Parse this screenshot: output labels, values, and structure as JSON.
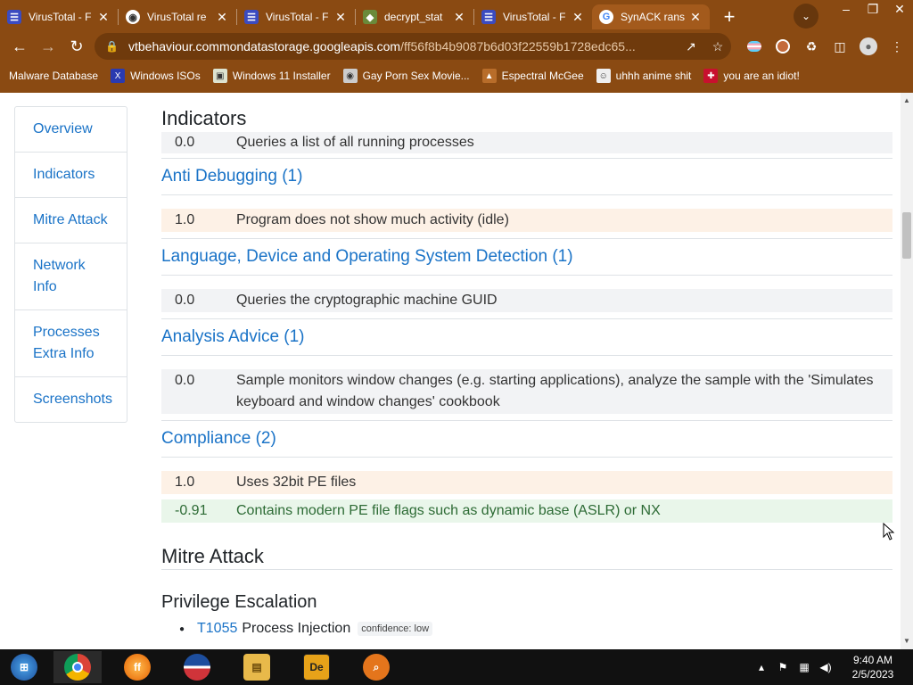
{
  "browser": {
    "tabs": [
      {
        "title": "VirusTotal - F",
        "favicon": "virustotal-icon",
        "color": "#3b4bc0",
        "active": false
      },
      {
        "title": "VirusTotal re",
        "favicon": "chrome-icon",
        "color": "#ffffff",
        "active": false
      },
      {
        "title": "VirusTotal - F",
        "favicon": "virustotal-icon",
        "color": "#3b4bc0",
        "active": false
      },
      {
        "title": "decrypt_stat",
        "favicon": "github-icon",
        "color": "#6a8a3a",
        "active": false
      },
      {
        "title": "VirusTotal - F",
        "favicon": "virustotal-icon",
        "color": "#3b4bc0",
        "active": false
      },
      {
        "title": "SynACK rans",
        "favicon": "google-icon",
        "color": "#ffffff",
        "active": true
      }
    ],
    "url_host": "vtbehaviour.commondatastorage.googleapis.com",
    "url_path": "/ff56f8b4b9087b6d03f22559b1728edc65...",
    "bookmarks": [
      {
        "label": "Malware Database",
        "icon": "bookmark-icon"
      },
      {
        "label": "Windows ISOs",
        "icon": "x-icon"
      },
      {
        "label": "Windows 11 Installer",
        "icon": "image-icon"
      },
      {
        "label": "Gay Porn Sex Movie...",
        "icon": "site-icon"
      },
      {
        "label": "Espectral McGee",
        "icon": "site-icon"
      },
      {
        "label": "uhhh anime shit",
        "icon": "anime-icon"
      },
      {
        "label": "you are an idiot!",
        "icon": "flag-icon"
      }
    ]
  },
  "sidenav": {
    "overview": "Overview",
    "indicators": "Indicators",
    "mitre": "Mitre Attack",
    "network": "Network Info",
    "processes": "Processes Extra Info",
    "screenshots": "Screenshots"
  },
  "report": {
    "indicators_heading": "Indicators",
    "top_row": {
      "score": "0.0",
      "desc": "Queries a list of all running processes"
    },
    "categories": [
      {
        "title": "Anti Debugging (1)",
        "rows": [
          {
            "score": "1.0",
            "desc": "Program does not show much activity (idle)",
            "level": "warn"
          }
        ]
      },
      {
        "title": "Language, Device and Operating System Detection (1)",
        "rows": [
          {
            "score": "0.0",
            "desc": "Queries the cryptographic machine GUID",
            "level": "neutral"
          }
        ]
      },
      {
        "title": "Analysis Advice (1)",
        "rows": [
          {
            "score": "0.0",
            "desc": "Sample monitors window changes (e.g. starting applications), analyze the sample with the 'Simulates keyboard and window changes' cookbook",
            "level": "neutral"
          }
        ]
      },
      {
        "title": "Compliance (2)",
        "rows": [
          {
            "score": "1.0",
            "desc": "Uses 32bit PE files",
            "level": "warn"
          },
          {
            "score": "-0.91",
            "desc": "Contains modern PE file flags such as dynamic base (ASLR) or NX",
            "level": "good"
          }
        ]
      }
    ],
    "mitre_heading": "Mitre Attack",
    "tactic": "Privilege Escalation",
    "technique": {
      "id": "T1055",
      "name": "Process Injection",
      "confidence": "confidence: low"
    }
  },
  "taskbar": {
    "apps": [
      "start-orb-icon",
      "chrome-icon",
      "firefox-icon",
      "obama-icon",
      "file-explorer-icon",
      "de-app-icon",
      "search-magnifier-icon"
    ],
    "time": "9:40 AM",
    "date": "2/5/2023"
  },
  "colors": {
    "link": "#1a73c7",
    "chrome": "#8a4a12",
    "warn_bg": "#fdf1e6",
    "good_bg": "#e9f6ea"
  }
}
